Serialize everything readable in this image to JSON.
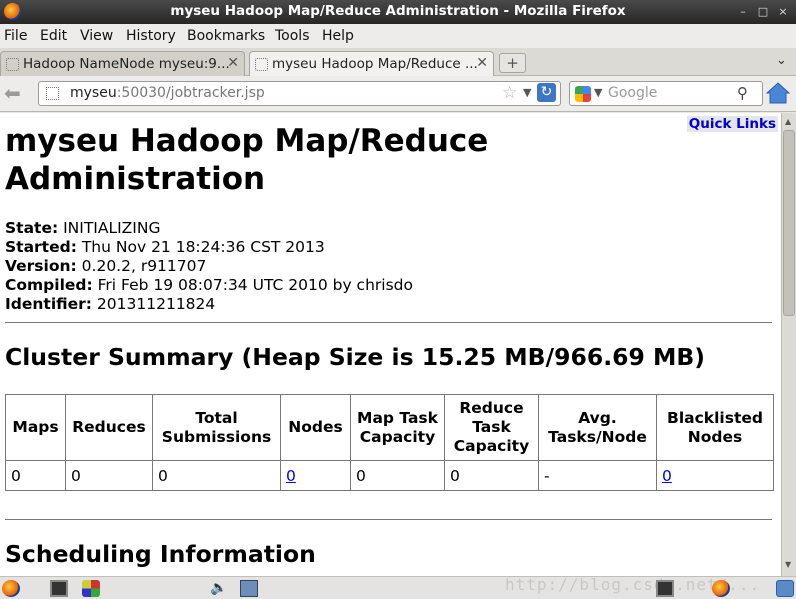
{
  "window": {
    "title": "myseu Hadoop Map/Reduce Administration - Mozilla Firefox"
  },
  "menu": [
    "File",
    "Edit",
    "View",
    "History",
    "Bookmarks",
    "Tools",
    "Help"
  ],
  "tabs": [
    {
      "label": "Hadoop NameNode myseu:9..."
    },
    {
      "label": "myseu Hadoop Map/Reduce ..."
    }
  ],
  "url": {
    "host": "myseu",
    "rest": ":50030/jobtracker.jsp"
  },
  "search": {
    "placeholder": "Google"
  },
  "page": {
    "quick_links": "Quick Links",
    "title": "myseu Hadoop Map/Reduce Administration",
    "info": [
      {
        "label": "State:",
        "value": "INITIALIZING"
      },
      {
        "label": "Started:",
        "value": "Thu Nov 21 18:24:36 CST 2013"
      },
      {
        "label": "Version:",
        "value": "0.20.2, r911707"
      },
      {
        "label": "Compiled:",
        "value": "Fri Feb 19 08:07:34 UTC 2010 by chrisdo"
      },
      {
        "label": "Identifier:",
        "value": "201311211824"
      }
    ],
    "cluster_heading": "Cluster Summary (Heap Size is 15.25 MB/966.69 MB)",
    "table_headers": [
      "Maps",
      "Reduces",
      "Total Submissions",
      "Nodes",
      "Map Task Capacity",
      "Reduce Task Capacity",
      "Avg. Tasks/Node",
      "Blacklisted Nodes"
    ],
    "table_row": [
      "0",
      "0",
      "0",
      "0",
      "0",
      "0",
      "-",
      "0"
    ],
    "scheduling_heading": "Scheduling Information"
  },
  "watermark": "http://blog.csdn.net/...",
  "colors": {
    "link": "#0000ee",
    "quick_links": "#0000c8",
    "titlebar": "#2e2e2e"
  }
}
